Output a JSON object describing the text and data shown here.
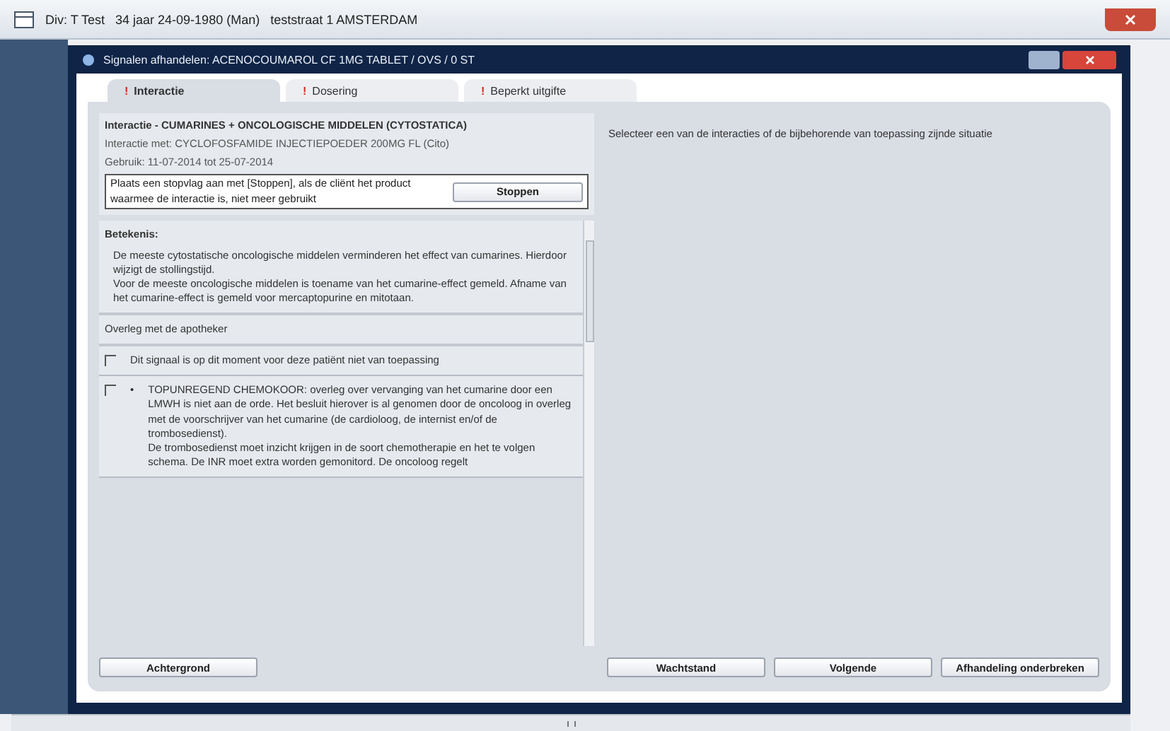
{
  "window": {
    "title": "Div: T Test   34 jaar 24-09-1980 (Man)   teststraat 1 AMSTERDAM"
  },
  "dialog": {
    "title": "Signalen afhandelen: ACENOCOUMAROL CF 1MG TABLET / OVS / 0 ST"
  },
  "tabs": [
    {
      "mark": "!",
      "label": "Interactie",
      "selected": true
    },
    {
      "mark": "!",
      "label": "Dosering",
      "selected": false
    },
    {
      "mark": "!",
      "label": "Beperkt uitgifte",
      "selected": false
    }
  ],
  "signal": {
    "heading": "Interactie - CUMARINES + ONCOLOGISCHE MIDDELEN (CYTOSTATICA)",
    "with": "Interactie met: CYCLOFOSFAMIDE INJECTIEPOEDER 200MG FL (Cito)",
    "usage": "Gebruik: 11-07-2014 tot 25-07-2014",
    "stop_hint": "Plaats een stopvlag aan met [Stoppen], als de cliënt het product waarmee de interactie is, niet meer gebruikt",
    "stop_button": "Stoppen"
  },
  "meaning": {
    "label": "Betekenis:",
    "text": [
      "De meeste cytostatische oncologische middelen verminderen het effect van cumarines. Hierdoor wijzigt de stollingstijd.",
      "Voor de meeste oncologische middelen is toename van het cumarine-effect gemeld. Afname van het cumarine-effect is gemeld voor mercaptopurine en mitotaan."
    ]
  },
  "advice": "Overleg met de apotheker",
  "options": [
    {
      "checked": false,
      "text": [
        "Dit signaal is op dit moment voor deze patiënt niet van toepassing"
      ]
    },
    {
      "checked": false,
      "bullet": "•",
      "text": [
        "TOPUNREGEND CHEMOKOOR: overleg over vervanging van het cumarine door een LMWH is niet aan de orde. Het besluit hierover is al genomen door de oncoloog in overleg met de voorschrijver van het cumarine (de cardioloog, de internist en/of de trombosedienst).",
        "De trombosedienst moet inzicht krijgen in de soort chemotherapie en het te volgen schema. De INR moet extra worden gemonitord. De oncoloog regelt"
      ]
    }
  ],
  "instruction": "Selecteer een van de interacties of de bijbehorende van toepassing zijnde situatie",
  "buttons": {
    "left": "Achtergrond",
    "right": [
      "Wachtstand",
      "Volgende",
      "Afhandeling onderbreken"
    ]
  }
}
